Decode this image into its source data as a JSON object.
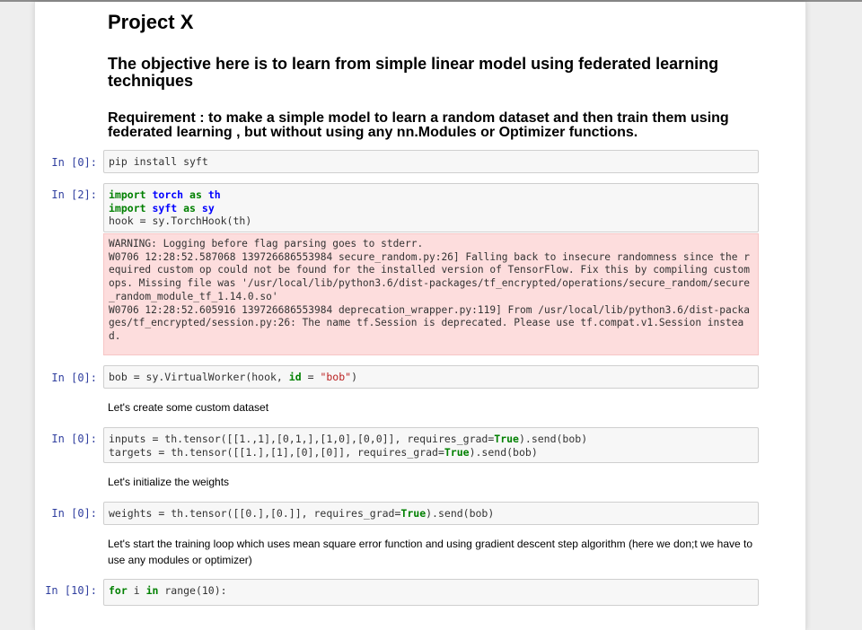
{
  "notebook": {
    "title": "Project X",
    "objective": "The objective here is to learn from simple linear model using federated learning techniques",
    "requirement": "Requirement : to make a simple model to learn a random dataset and then train them using federated learning , but without using any nn.Modules or Optimizer functions."
  },
  "cells": {
    "c1": {
      "prompt": "In [0]:",
      "code": "pip install syft"
    },
    "c2": {
      "prompt": "In [2]:",
      "l1_a": "import",
      "l1_b": "torch",
      "l1_c": "as",
      "l1_d": "th",
      "l2_a": "import",
      "l2_b": "syft",
      "l2_c": "as",
      "l2_d": "sy",
      "l3": "hook = sy.TorchHook(th)",
      "stderr": "WARNING: Logging before flag parsing goes to stderr.\nW0706 12:28:52.587068 139726686553984 secure_random.py:26] Falling back to insecure randomness since the r\nequired custom op could not be found for the installed version of TensorFlow. Fix this by compiling custom\nops. Missing file was '/usr/local/lib/python3.6/dist-packages/tf_encrypted/operations/secure_random/secure\n_random_module_tf_1.14.0.so'\nW0706 12:28:52.605916 139726686553984 deprecation_wrapper.py:119] From /usr/local/lib/python3.6/dist-packa\nges/tf_encrypted/session.py:26: The name tf.Session is deprecated. Please use tf.compat.v1.Session instea\nd."
    },
    "c3": {
      "prompt": "In [0]:",
      "a": "bob = sy.VirtualWorker(hook, ",
      "b": "id",
      "c": " = ",
      "d": "\"bob\"",
      "e": ")"
    },
    "md1": "Let's create some custom dataset",
    "c4": {
      "prompt": "In [0]:",
      "l1a": "inputs = th.tensor([[1.,1],[0,1,],[1,0],[0,0]], requires_grad=",
      "l1b": "True",
      "l1c": ").send(bob)",
      "l2a": "targets = th.tensor([[1.],[1],[0],[0]], requires_grad=",
      "l2b": "True",
      "l2c": ").send(bob)"
    },
    "md2": "Let's initialize the weights",
    "c5": {
      "prompt": "In [0]:",
      "a": "weights = th.tensor([[0.],[0.]], requires_grad=",
      "b": "True",
      "c": ").send(bob)"
    },
    "md3": "Let's start the training loop which uses mean square error function and using gradient descent step algorithm (here we don;t we have to use any modules or optimizer)",
    "c6": {
      "prompt": "In [10]:",
      "a": "for",
      "b": " i ",
      "c": "in",
      "d": " range(10):"
    }
  },
  "colors": {
    "prompt": "#303f9f",
    "keyword": "#008000",
    "stderr_bg": "#fddddd",
    "cell_bg": "#f7f7f7"
  }
}
